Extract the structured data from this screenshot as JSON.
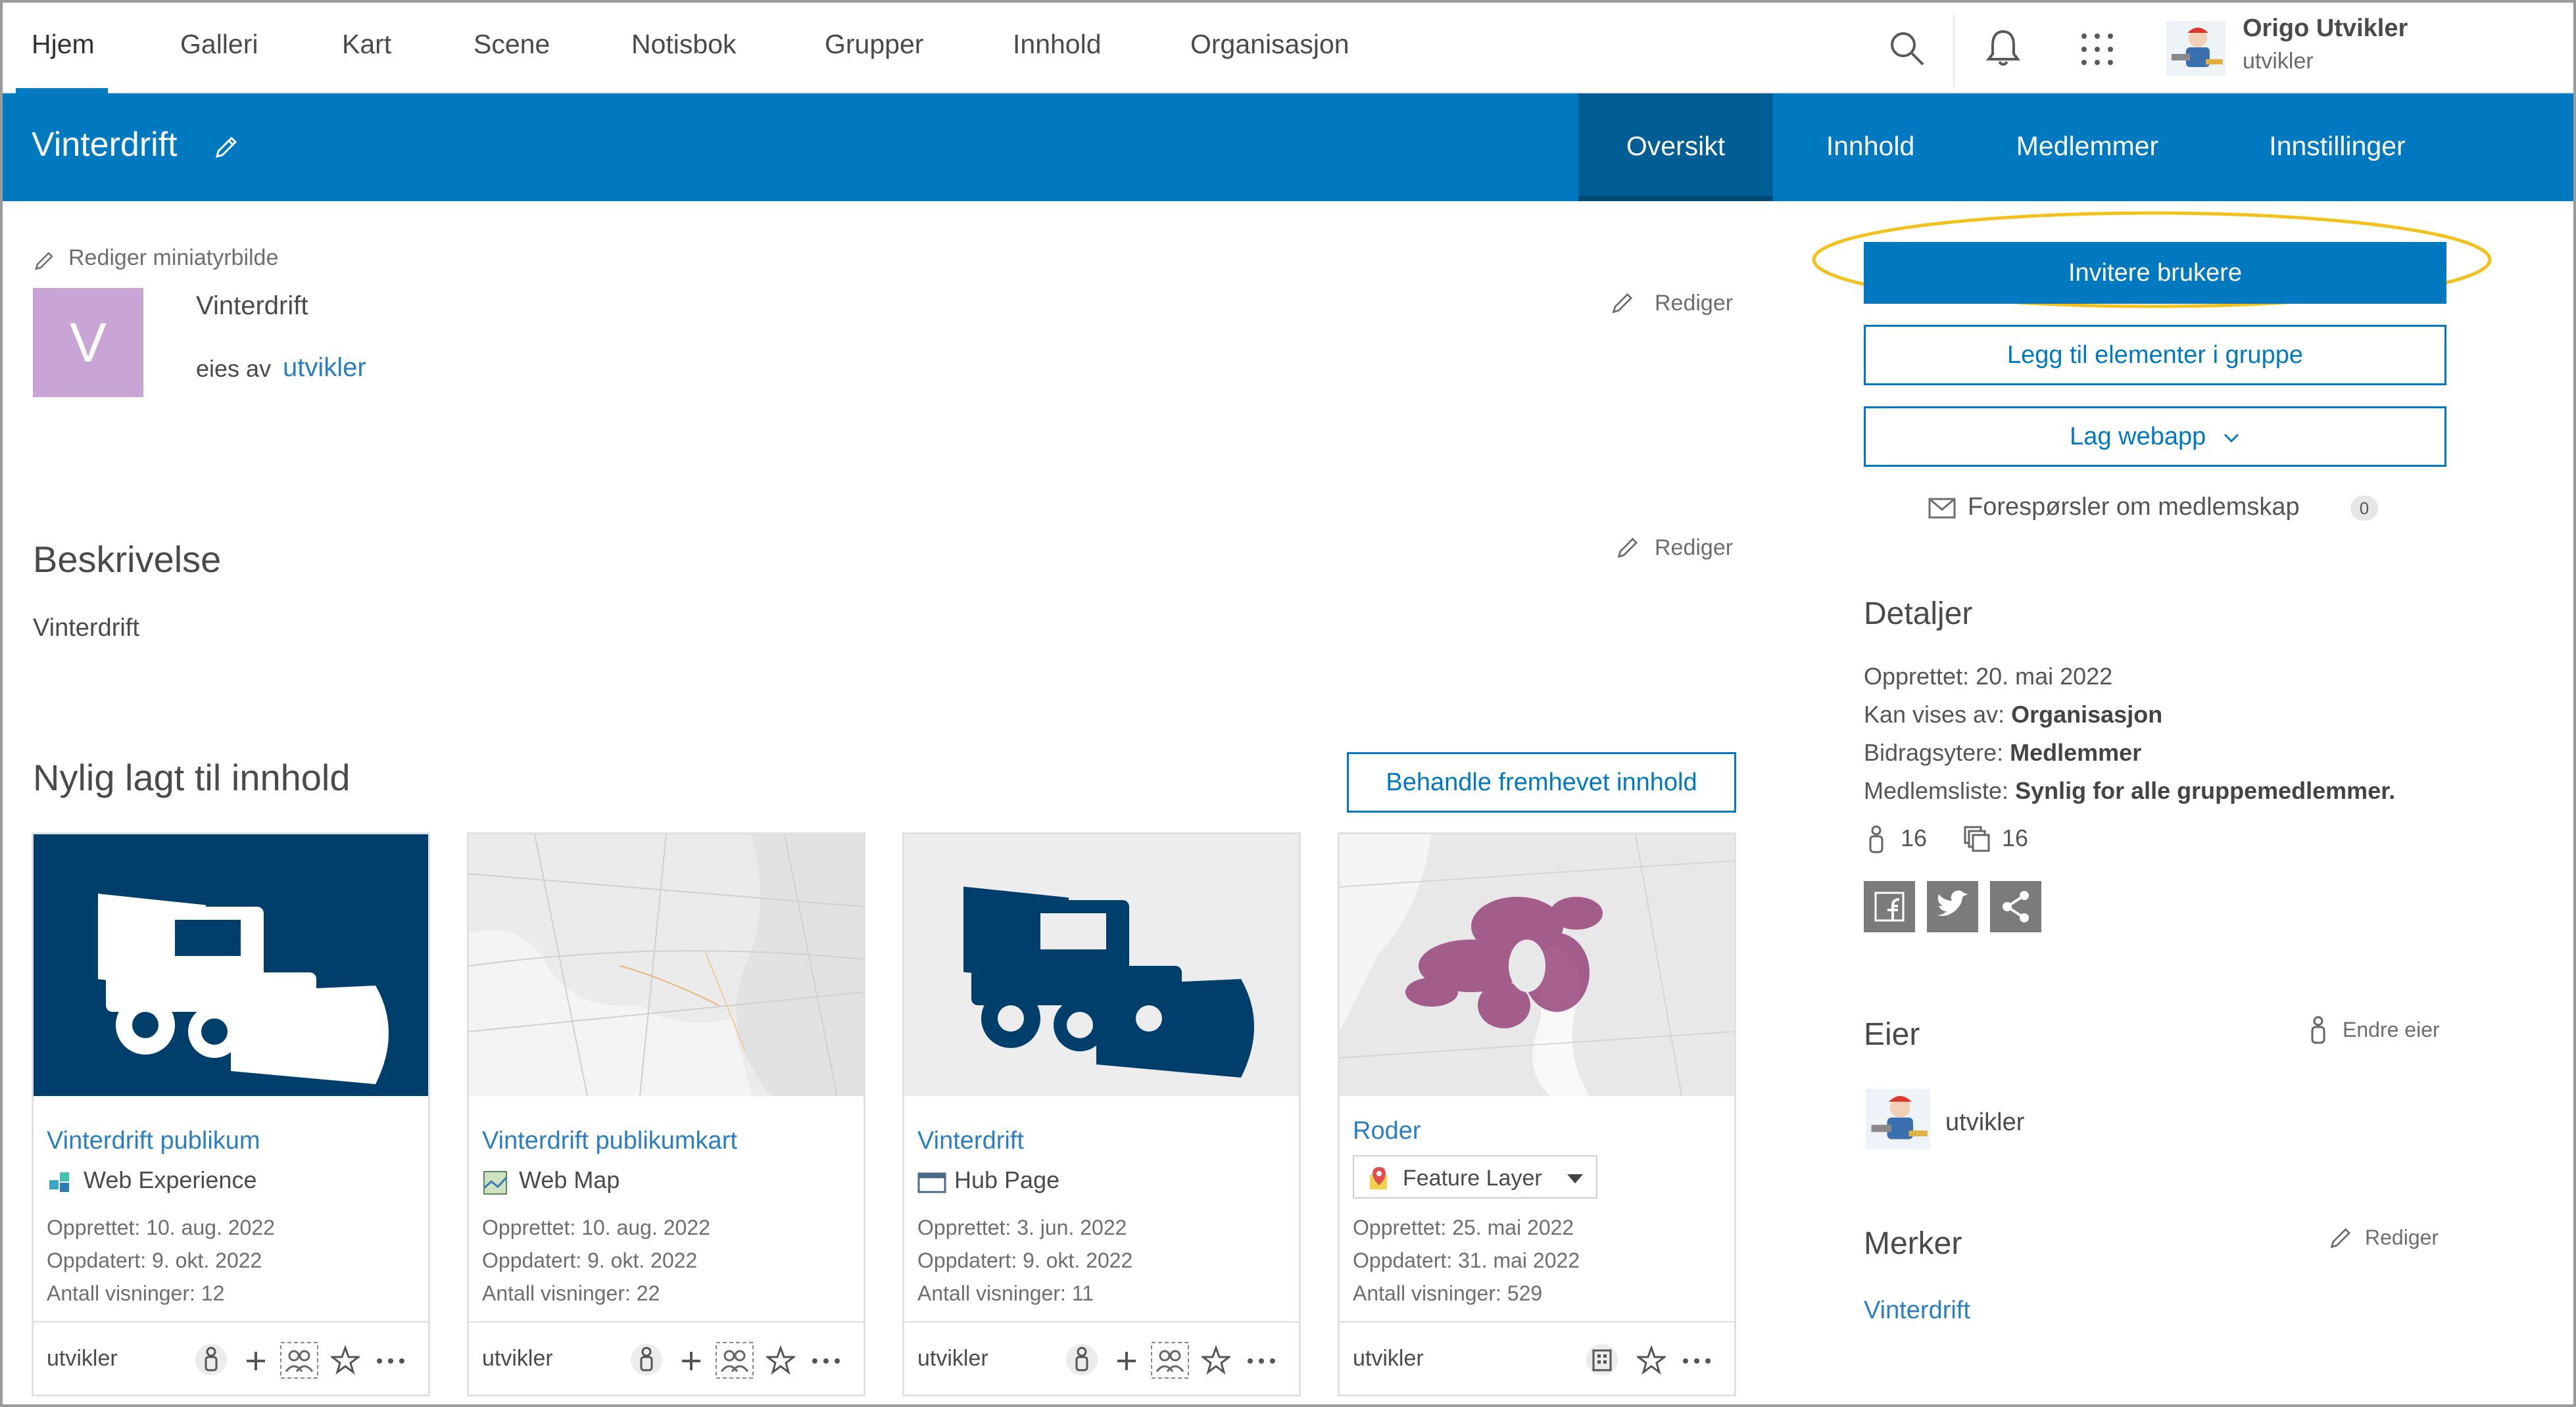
{
  "topnav": {
    "items": [
      "Hjem",
      "Galleri",
      "Kart",
      "Scene",
      "Notisbok",
      "Grupper",
      "Innhold",
      "Organisasjon"
    ],
    "user_name": "Origo Utvikler",
    "user_sub": "utvikler"
  },
  "group": {
    "title": "Vinterdrift",
    "tabs": [
      "Oversikt",
      "Innhold",
      "Medlemmer",
      "Innstillinger"
    ],
    "edit_thumbnail": "Rediger miniatyrbilde",
    "thumb_letter": "V",
    "name": "Vinterdrift",
    "owned_prefix": "eies av",
    "owned_by": "utvikler",
    "edit": "Rediger"
  },
  "description": {
    "heading": "Beskrivelse",
    "edit": "Rediger",
    "text": "Vinterdrift"
  },
  "recent": {
    "heading": "Nylig lagt til innhold",
    "manage_button": "Behandle fremhevet innhold",
    "cards": [
      {
        "title": "Vinterdrift publikum",
        "type": "Web Experience",
        "created": "Opprettet: 10. aug. 2022",
        "updated": "Oppdatert: 9. okt. 2022",
        "views": "Antall visninger: 12",
        "owner": "utvikler"
      },
      {
        "title": "Vinterdrift publikumkart",
        "type": "Web Map",
        "created": "Opprettet: 10. aug. 2022",
        "updated": "Oppdatert: 9. okt. 2022",
        "views": "Antall visninger: 22",
        "owner": "utvikler"
      },
      {
        "title": "Vinterdrift",
        "type": "Hub Page",
        "created": "Opprettet: 3. jun. 2022",
        "updated": "Oppdatert: 9. okt. 2022",
        "views": "Antall visninger: 11",
        "owner": "utvikler"
      },
      {
        "title": "Roder",
        "type": "Feature Layer",
        "created": "Opprettet: 25. mai 2022",
        "updated": "Oppdatert: 31. mai 2022",
        "views": "Antall visninger: 529",
        "owner": "utvikler"
      }
    ]
  },
  "sidebar": {
    "invite_button": "Invitere brukere",
    "add_items_button": "Legg til elementer i gruppe",
    "create_app_button": "Lag webapp",
    "requests_label": "Forespørsler om medlemskap",
    "requests_count": "0",
    "details_heading": "Detaljer",
    "created_label": "Opprettet: 20. mai 2022",
    "visible_label": "Kan vises av:",
    "visible_value": "Organisasjon",
    "contributors_label": "Bidragsytere:",
    "contributors_value": "Medlemmer",
    "memberlist_label": "Medlemsliste:",
    "memberlist_value": "Synlig for alle gruppemedlemmer.",
    "members_count": "16",
    "items_count": "16",
    "owner_heading": "Eier",
    "change_owner": "Endre eier",
    "owner_name": "utvikler",
    "tags_heading": "Merker",
    "tags_edit": "Rediger",
    "tag": "Vinterdrift"
  },
  "colors": {
    "brand_blue": "#0079c1",
    "band_active": "#005e95",
    "highlight_ellipse": "#f2c11a",
    "thumb_purple": "#c9a5d6"
  }
}
